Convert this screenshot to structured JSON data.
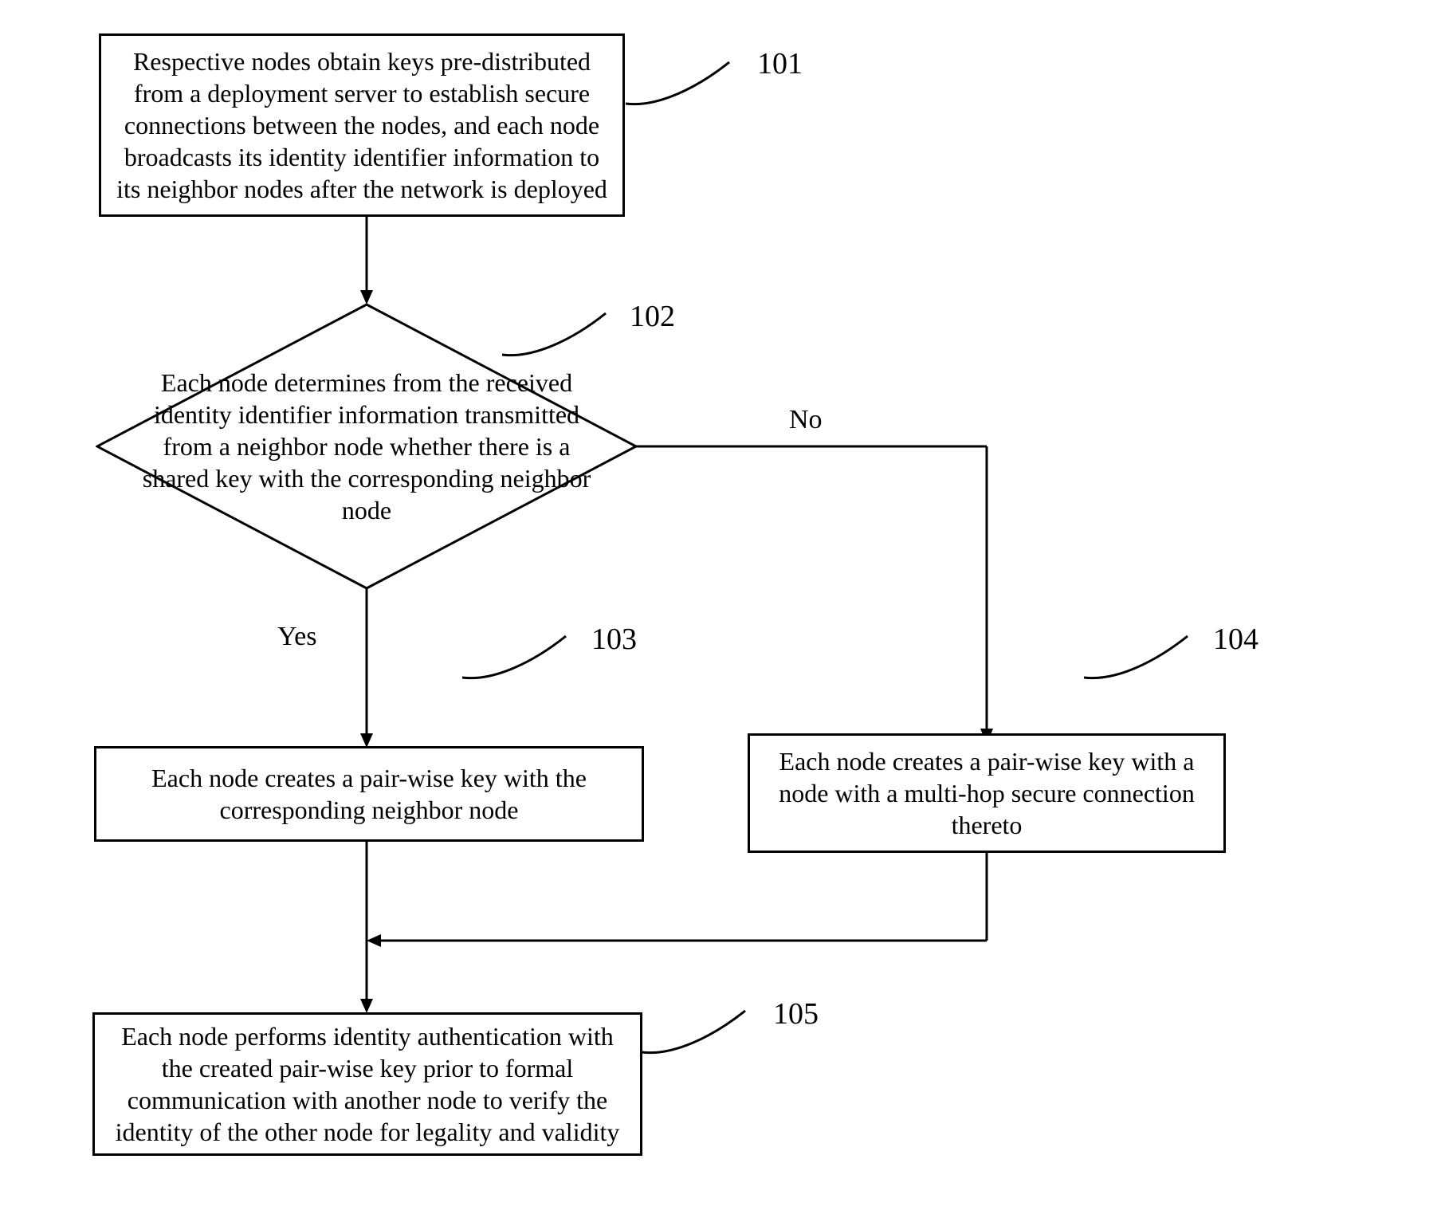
{
  "nodes": {
    "n101": {
      "label": "101",
      "text": "Respective nodes obtain keys pre-distributed from a deployment server to establish secure connections between the nodes, and each node broadcasts its identity identifier information to its neighbor nodes after the network is deployed"
    },
    "n102": {
      "label": "102",
      "text": "Each node determines from the received identity identifier information transmitted from a neighbor node whether there is a shared key with the corresponding neighbor node"
    },
    "n103": {
      "label": "103",
      "text": "Each node creates a pair-wise key with the corresponding neighbor node"
    },
    "n104": {
      "label": "104",
      "text": "Each node creates a pair-wise key with a node with a multi-hop secure connection thereto"
    },
    "n105": {
      "label": "105",
      "text": "Each node performs identity authentication with the created pair-wise key prior to formal communication with another node to verify the identity of the other node for legality and validity"
    }
  },
  "edges": {
    "yes": "Yes",
    "no": "No"
  }
}
